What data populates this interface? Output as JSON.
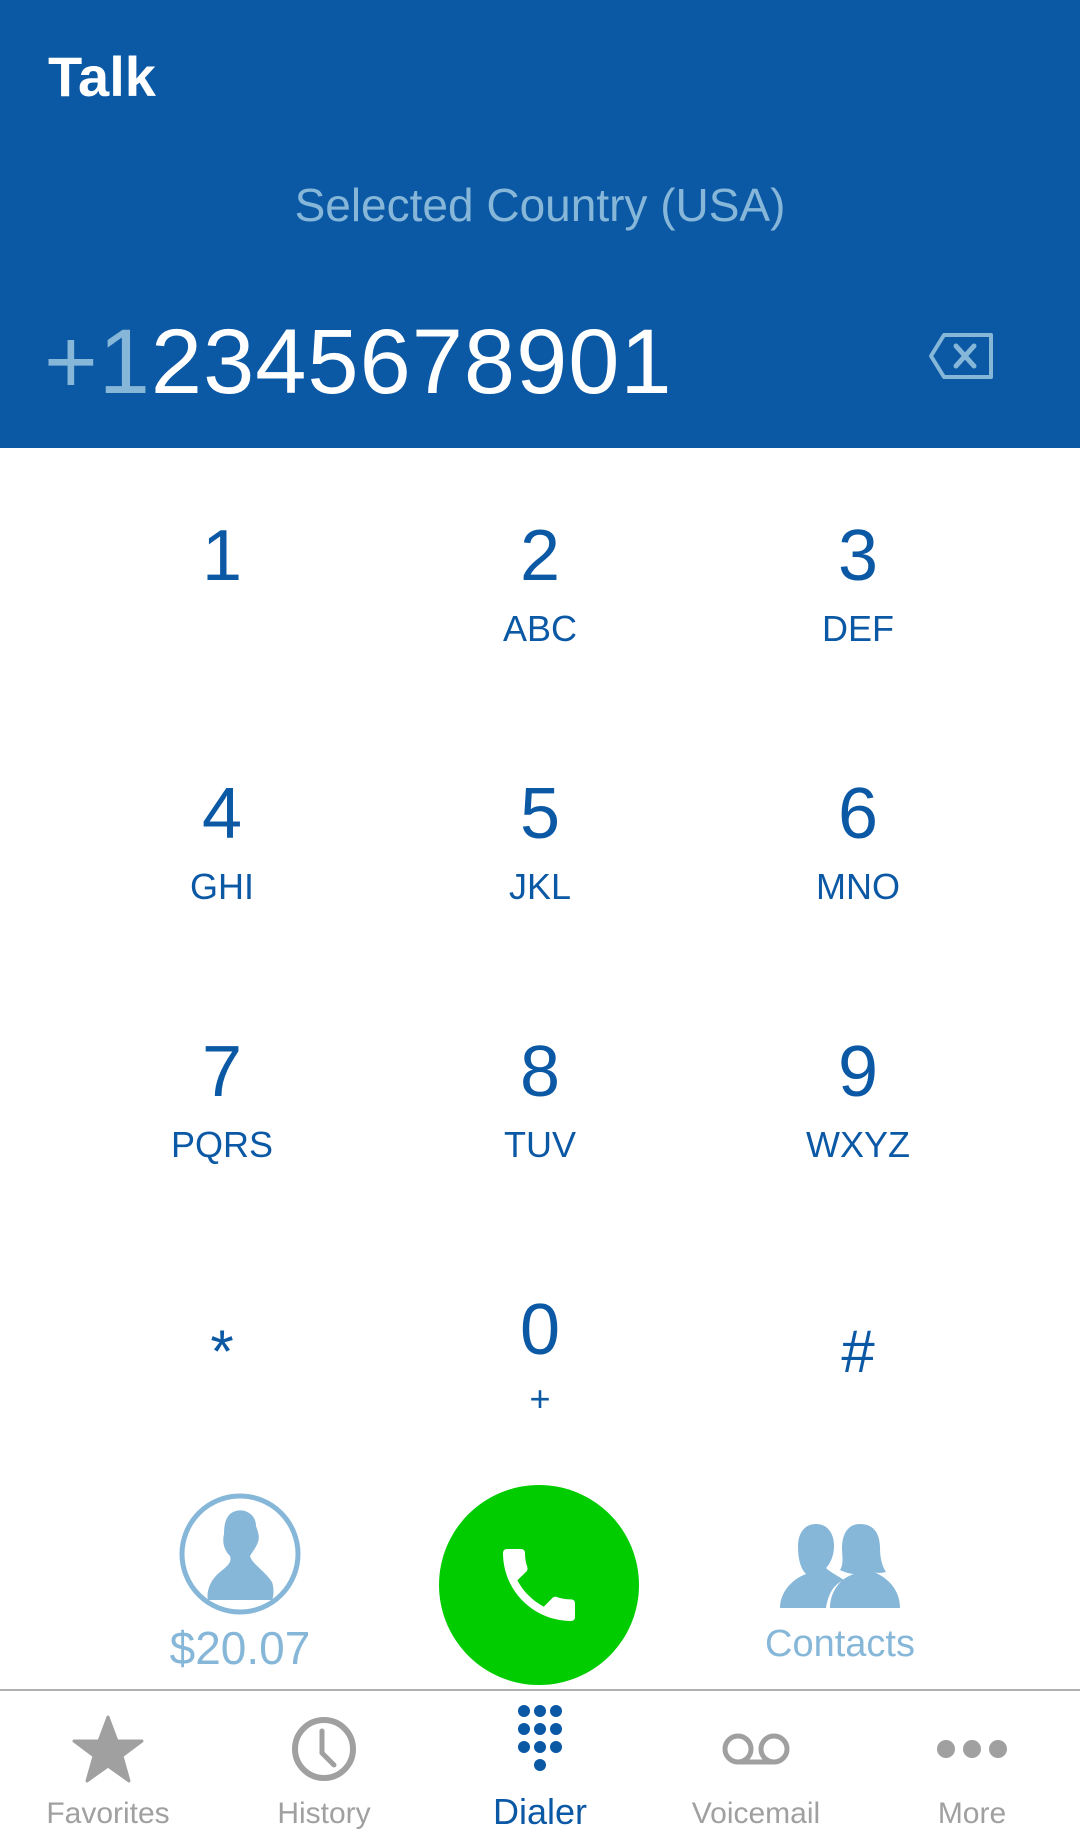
{
  "header": {
    "app_title": "Talk",
    "selected_country": "Selected Country (USA)",
    "number_prefix": "+1",
    "number_rest": "2345678901",
    "backspace_icon": "backspace-icon"
  },
  "keypad": {
    "keys": [
      {
        "digit": "1",
        "letters": ""
      },
      {
        "digit": "2",
        "letters": "ABC"
      },
      {
        "digit": "3",
        "letters": "DEF"
      },
      {
        "digit": "4",
        "letters": "GHI"
      },
      {
        "digit": "5",
        "letters": "JKL"
      },
      {
        "digit": "6",
        "letters": "MNO"
      },
      {
        "digit": "7",
        "letters": "PQRS"
      },
      {
        "digit": "8",
        "letters": "TUV"
      },
      {
        "digit": "9",
        "letters": "WXYZ"
      },
      {
        "digit": "*",
        "letters": ""
      },
      {
        "digit": "0",
        "letters": "+"
      },
      {
        "digit": "#",
        "letters": ""
      }
    ]
  },
  "actions": {
    "balance": "$20.07",
    "balance_icon": "account-avatar-icon",
    "call_icon": "phone-icon",
    "contacts_label": "Contacts",
    "contacts_icon": "contacts-icon"
  },
  "colors": {
    "brand_blue": "#0b58a5",
    "light_blue": "#86b7d8",
    "call_green": "#00cc00",
    "inactive_gray": "#a0a0a0"
  },
  "bottom_nav": {
    "items": [
      {
        "label": "Favorites",
        "icon": "star-icon",
        "active": false
      },
      {
        "label": "History",
        "icon": "clock-icon",
        "active": false
      },
      {
        "label": "Dialer",
        "icon": "dialpad-icon",
        "active": true
      },
      {
        "label": "Voicemail",
        "icon": "voicemail-icon",
        "active": false
      },
      {
        "label": "More",
        "icon": "more-icon",
        "active": false
      }
    ]
  }
}
